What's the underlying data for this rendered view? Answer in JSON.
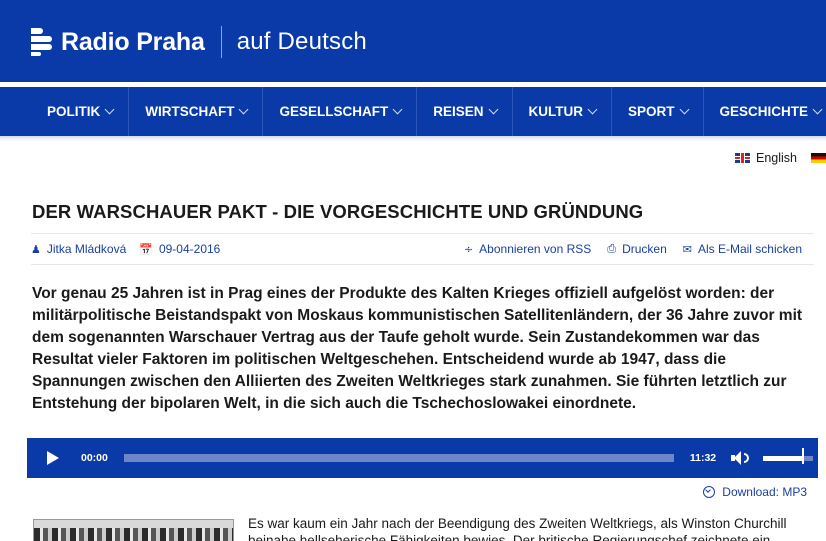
{
  "header": {
    "brand": "Radio Praha",
    "subtitle": "auf Deutsch"
  },
  "nav": {
    "items": [
      "POLITIK",
      "WIRTSCHAFT",
      "GESELLSCHAFT",
      "REISEN",
      "KULTUR",
      "SPORT",
      "GESCHICHTE"
    ]
  },
  "language": {
    "english_label": "English"
  },
  "article": {
    "title": "DER WARSCHAUER PAKT - DIE VORGESCHICHTE UND GRÜNDUNG",
    "author": "Jitka Mládková",
    "date": "09-04-2016",
    "actions": {
      "rss": "Abonnieren von RSS",
      "print": "Drucken",
      "email": "Als E-Mail schicken"
    },
    "lead": "Vor genau 25 Jahren ist in Prag eines der Produkte des Kalten Krieges offiziell aufgelöst worden: der militärpolitische Beistandspakt von Moskaus kommunistischen Satellitenländern, der 36 Jahre zuvor mit dem sogenannten Warschauer Vertrag aus der Taufe geholt wurde. Sein Zustandekommen war das Resultat vieler Faktoren im politischen Weltgeschehen. Entscheidend wurde ab 1947, dass die Spannungen zwischen den Alliierten des Zweiten Weltkrieges stark zunahmen. Sie führten letztlich zur Entstehung der bipolaren Welt, in die sich auch die Tschechoslowakei einordnete.",
    "body": "Es war kaum ein Jahr nach der Beendigung des Zweiten Weltkriegs, als Winston Churchill beinahe hellseherische Fähigkeiten bewies. Der britische Regierungschef zeichnete ein"
  },
  "player": {
    "current_time": "00:00",
    "duration": "11:32",
    "progress": 0,
    "volume": 0.8,
    "download_label": "Download: MP3"
  },
  "colors": {
    "brand_blue": "#0a3aa8",
    "link_blue": "#1a3f9e"
  }
}
